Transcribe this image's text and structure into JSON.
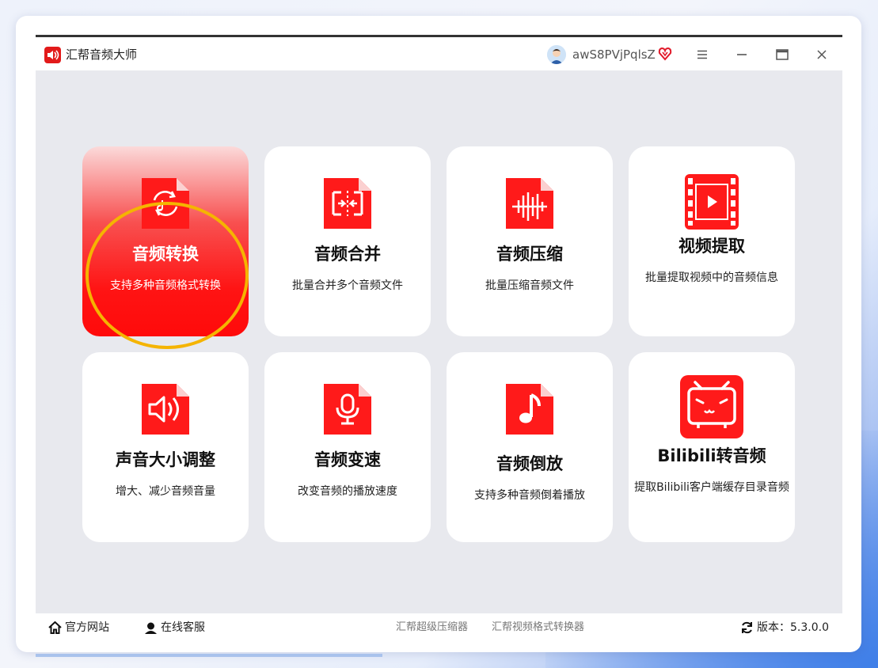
{
  "window": {
    "title": "汇帮音频大师",
    "username": "awS8PVjPqlsZ"
  },
  "icons": {
    "app": "speaker-icon",
    "user": "avatar-icon",
    "vip": "heart-diamond-icon",
    "menu": "hamburger-icon",
    "minimize": "minimize-icon",
    "maximize": "maximize-icon",
    "close": "close-icon"
  },
  "colors": {
    "accent": "#ff1414",
    "highlight_ring": "#f5b400",
    "content_bg": "#e8e9ee"
  },
  "features": [
    {
      "title": "音频转换",
      "desc": "支持多种音频格式转换",
      "icon": "audio-convert-icon",
      "active": true
    },
    {
      "title": "音频合并",
      "desc": "批量合并多个音频文件",
      "icon": "audio-merge-icon"
    },
    {
      "title": "音频压缩",
      "desc": "批量压缩音频文件",
      "icon": "audio-compress-icon"
    },
    {
      "title": "视频提取",
      "desc": "批量提取视频中的音频信息",
      "icon": "film-icon"
    },
    {
      "title": "声音大小调整",
      "desc": "增大、减少音频音量",
      "icon": "volume-icon"
    },
    {
      "title": "音频变速",
      "desc": "改变音频的播放速度",
      "icon": "microphone-icon"
    },
    {
      "title": "音频倒放",
      "desc": "支持多种音频倒着播放",
      "icon": "music-note-icon"
    },
    {
      "title": "Bilibili转音频",
      "desc": "提取Bilibili客户端缓存目录音频",
      "icon": "bilibili-tv-icon"
    }
  ],
  "footer": {
    "website": "官方网站",
    "support": "在线客服",
    "link1": "汇帮超级压缩器",
    "link2": "汇帮视频格式转换器",
    "version": "版本：5.3.0.0"
  }
}
